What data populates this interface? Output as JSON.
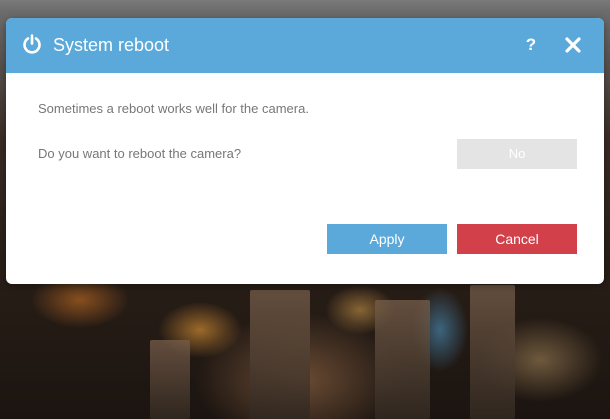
{
  "dialog": {
    "title": "System reboot",
    "help_label": "?",
    "message": "Sometimes a reboot works well for the camera.",
    "question": "Do you want to reboot the camera?",
    "toggle_value": "No",
    "apply_label": "Apply",
    "cancel_label": "Cancel"
  },
  "icons": {
    "title": "power-icon",
    "help": "help-icon",
    "close": "close-icon"
  },
  "colors": {
    "accent": "#5aa9da",
    "cancel": "#d2404a",
    "toggle_bg": "#e4e4e4",
    "text": "#777777"
  }
}
